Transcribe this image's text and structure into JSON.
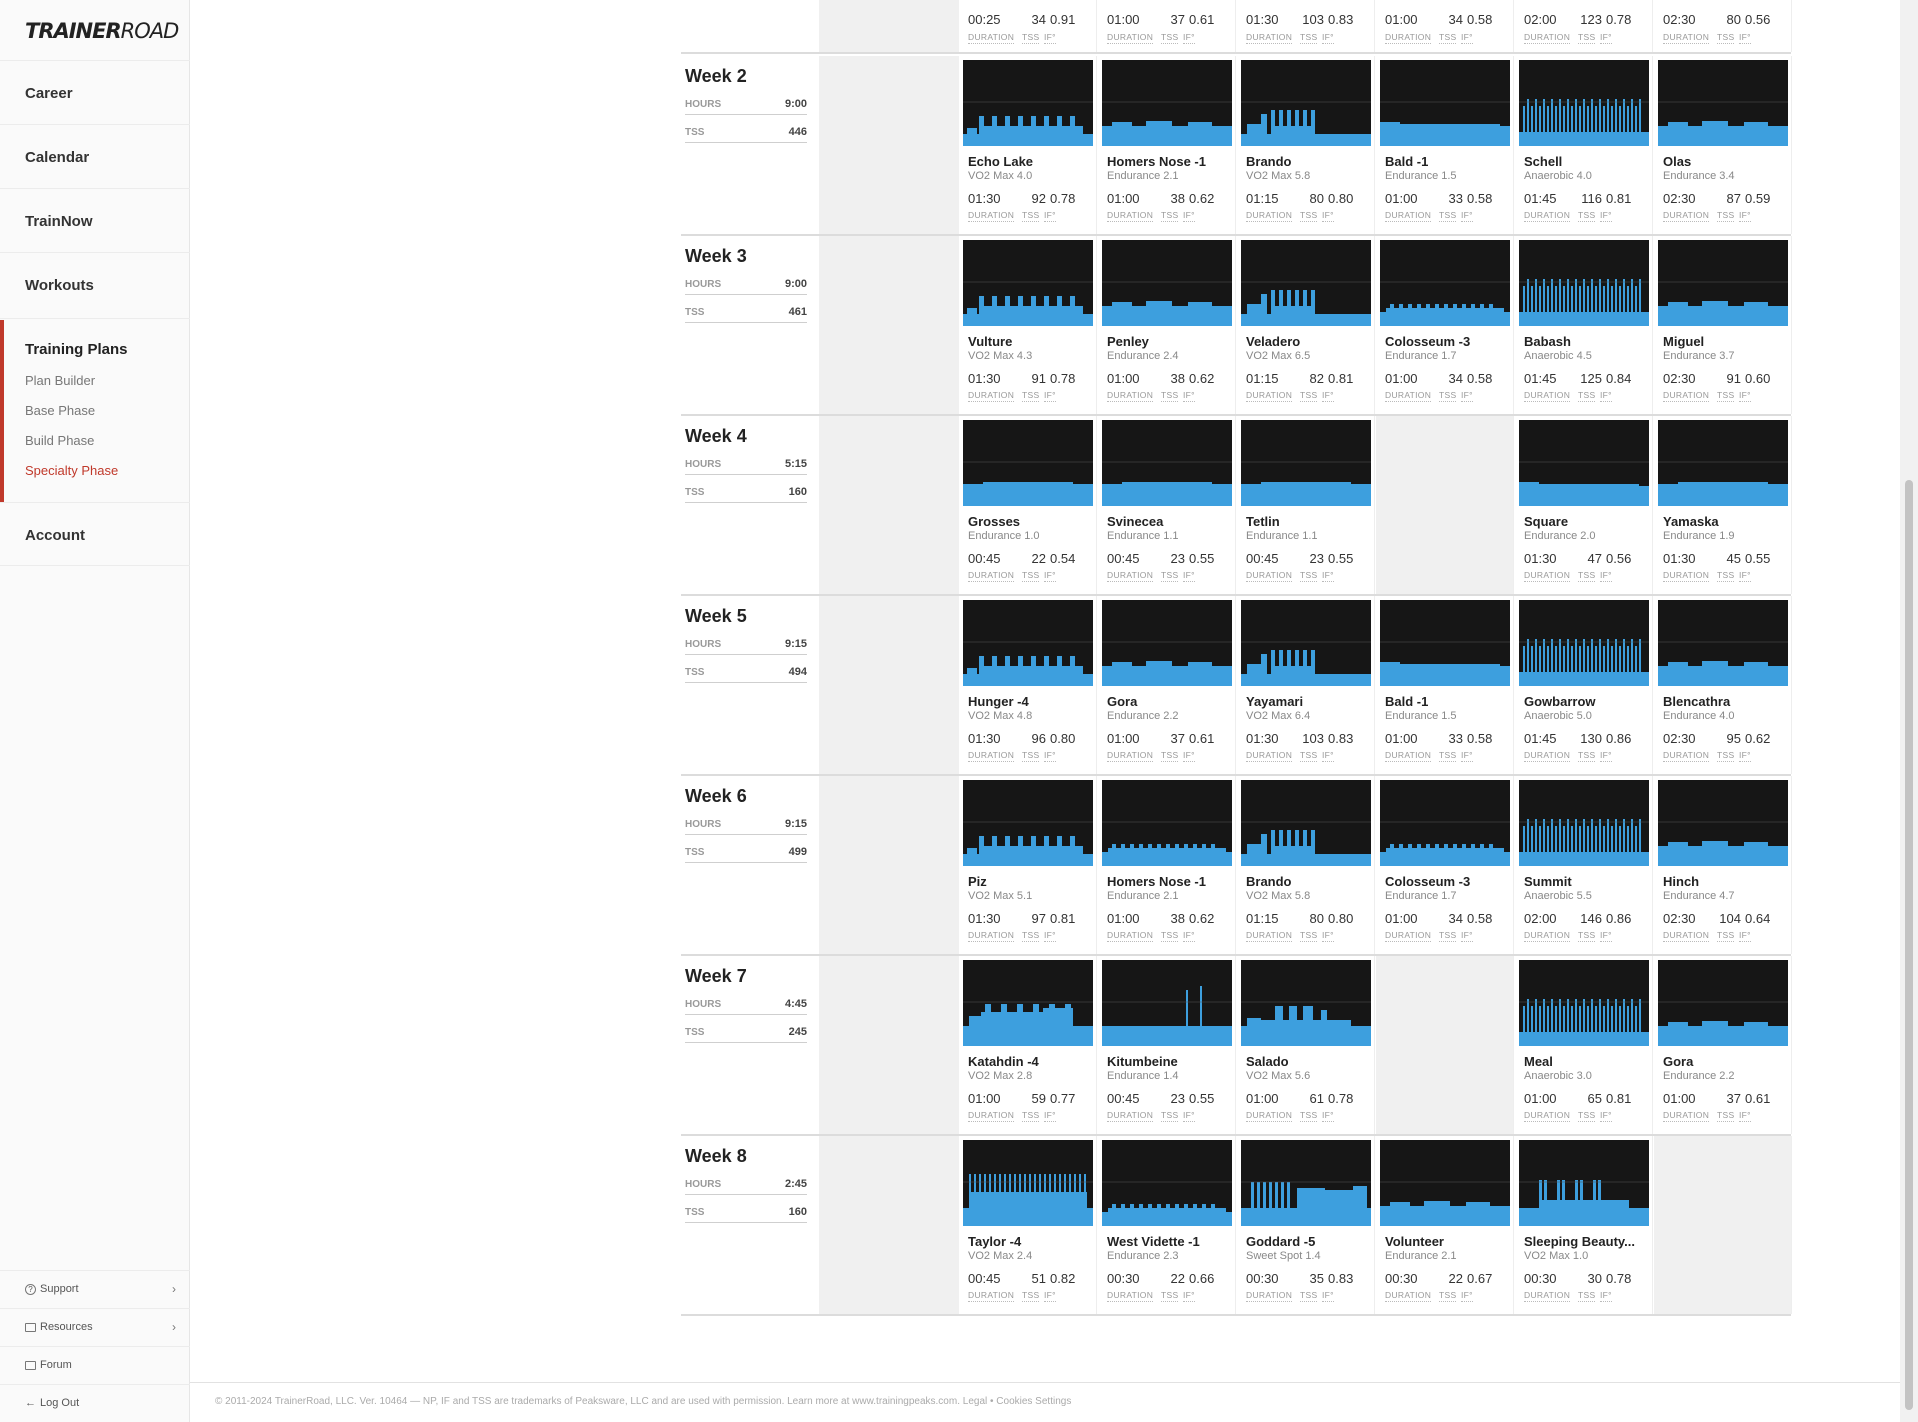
{
  "brand": {
    "bold": "TRAINER",
    "light": "ROAD"
  },
  "nav": {
    "career": "Career",
    "calendar": "Calendar",
    "trainnow": "TrainNow",
    "workouts": "Workouts",
    "training_plans": "Training Plans",
    "sub": [
      "Plan Builder",
      "Base Phase",
      "Build Phase",
      "Specialty Phase"
    ],
    "account": "Account"
  },
  "bottom_nav": {
    "support": "Support",
    "resources": "Resources",
    "forum": "Forum",
    "logout": "Log Out"
  },
  "labels": {
    "hours": "HOURS",
    "tss": "TSS",
    "duration": "DURATION",
    "tss_short": "TSS",
    "if": "IF°"
  },
  "footer": "© 2011-2024 TrainerRoad, LLC. Ver. 10464 — NP, IF and TSS are trademarks of Peaksware, LLC and are used with permission. Learn more at www.trainingpeaks.com. Legal • Cookies Settings",
  "week1_partial": [
    {
      "d": "00:25",
      "t": "34",
      "i": "0.91"
    },
    {
      "d": "01:00",
      "t": "37",
      "i": "0.61"
    },
    {
      "d": "01:30",
      "t": "103",
      "i": "0.83"
    },
    {
      "d": "01:00",
      "t": "34",
      "i": "0.58"
    },
    {
      "d": "02:00",
      "t": "123",
      "i": "0.78"
    },
    {
      "d": "02:30",
      "t": "80",
      "i": "0.56"
    }
  ],
  "weeks": [
    {
      "title": "Week 2",
      "hours": "9:00",
      "tss": "446",
      "workouts": [
        {
          "n": "Echo Lake",
          "z": "VO2 Max 4.0",
          "d": "01:30",
          "t": "92",
          "i": "0.78",
          "p": "vo2"
        },
        {
          "n": "Homers Nose -1",
          "z": "Endurance 2.1",
          "d": "01:00",
          "t": "38",
          "i": "0.62",
          "p": "endb"
        },
        {
          "n": "Brando",
          "z": "VO2 Max 5.8",
          "d": "01:15",
          "t": "80",
          "i": "0.80",
          "p": "short"
        },
        {
          "n": "Bald -1",
          "z": "Endurance 1.5",
          "d": "01:00",
          "t": "33",
          "i": "0.58",
          "p": "endf"
        },
        {
          "n": "Schell",
          "z": "Anaerobic 4.0",
          "d": "01:45",
          "t": "116",
          "i": "0.81",
          "p": "anae"
        },
        {
          "n": "Olas",
          "z": "Endurance 3.4",
          "d": "02:30",
          "t": "87",
          "i": "0.59",
          "p": "endb"
        }
      ]
    },
    {
      "title": "Week 3",
      "hours": "9:00",
      "tss": "461",
      "workouts": [
        {
          "n": "Vulture",
          "z": "VO2 Max 4.3",
          "d": "01:30",
          "t": "91",
          "i": "0.78",
          "p": "vo2"
        },
        {
          "n": "Penley",
          "z": "Endurance 2.4",
          "d": "01:00",
          "t": "38",
          "i": "0.62",
          "p": "endb"
        },
        {
          "n": "Veladero",
          "z": "VO2 Max 6.5",
          "d": "01:15",
          "t": "82",
          "i": "0.81",
          "p": "short"
        },
        {
          "n": "Colosseum -3",
          "z": "Endurance 1.7",
          "d": "01:00",
          "t": "34",
          "i": "0.58",
          "p": "endm"
        },
        {
          "n": "Babash",
          "z": "Anaerobic 4.5",
          "d": "01:45",
          "t": "125",
          "i": "0.84",
          "p": "anae"
        },
        {
          "n": "Miguel",
          "z": "Endurance 3.7",
          "d": "02:30",
          "t": "91",
          "i": "0.60",
          "p": "endb"
        }
      ]
    },
    {
      "title": "Week 4",
      "hours": "5:15",
      "tss": "160",
      "workouts": [
        {
          "n": "Grosses",
          "z": "Endurance 1.0",
          "d": "00:45",
          "t": "22",
          "i": "0.54",
          "p": "flat"
        },
        {
          "n": "Svinecea",
          "z": "Endurance 1.1",
          "d": "00:45",
          "t": "23",
          "i": "0.55",
          "p": "flat"
        },
        {
          "n": "Tetlin",
          "z": "Endurance 1.1",
          "d": "00:45",
          "t": "23",
          "i": "0.55",
          "p": "flat"
        },
        null,
        {
          "n": "Square",
          "z": "Endurance 2.0",
          "d": "01:30",
          "t": "47",
          "i": "0.56",
          "p": "endf"
        },
        {
          "n": "Yamaska",
          "z": "Endurance 1.9",
          "d": "01:30",
          "t": "45",
          "i": "0.55",
          "p": "flat"
        }
      ]
    },
    {
      "title": "Week 5",
      "hours": "9:15",
      "tss": "494",
      "workouts": [
        {
          "n": "Hunger -4",
          "z": "VO2 Max 4.8",
          "d": "01:30",
          "t": "96",
          "i": "0.80",
          "p": "vo2"
        },
        {
          "n": "Gora",
          "z": "Endurance 2.2",
          "d": "01:00",
          "t": "37",
          "i": "0.61",
          "p": "endb"
        },
        {
          "n": "Yayamari",
          "z": "VO2 Max 6.4",
          "d": "01:30",
          "t": "103",
          "i": "0.83",
          "p": "short"
        },
        {
          "n": "Bald -1",
          "z": "Endurance 1.5",
          "d": "01:00",
          "t": "33",
          "i": "0.58",
          "p": "endf"
        },
        {
          "n": "Gowbarrow",
          "z": "Anaerobic 5.0",
          "d": "01:45",
          "t": "130",
          "i": "0.86",
          "p": "anae"
        },
        {
          "n": "Blencathra",
          "z": "Endurance 4.0",
          "d": "02:30",
          "t": "95",
          "i": "0.62",
          "p": "endb"
        }
      ]
    },
    {
      "title": "Week 6",
      "hours": "9:15",
      "tss": "499",
      "workouts": [
        {
          "n": "Piz",
          "z": "VO2 Max 5.1",
          "d": "01:30",
          "t": "97",
          "i": "0.81",
          "p": "vo2"
        },
        {
          "n": "Homers Nose -1",
          "z": "Endurance 2.1",
          "d": "01:00",
          "t": "38",
          "i": "0.62",
          "p": "endm"
        },
        {
          "n": "Brando",
          "z": "VO2 Max 5.8",
          "d": "01:15",
          "t": "80",
          "i": "0.80",
          "p": "short"
        },
        {
          "n": "Colosseum -3",
          "z": "Endurance 1.7",
          "d": "01:00",
          "t": "34",
          "i": "0.58",
          "p": "endm"
        },
        {
          "n": "Summit",
          "z": "Anaerobic 5.5",
          "d": "02:00",
          "t": "146",
          "i": "0.86",
          "p": "anae"
        },
        {
          "n": "Hinch",
          "z": "Endurance 4.7",
          "d": "02:30",
          "t": "104",
          "i": "0.64",
          "p": "endb"
        }
      ]
    },
    {
      "title": "Week 7",
      "hours": "4:45",
      "tss": "245",
      "workouts": [
        {
          "n": "Katahdin -4",
          "z": "VO2 Max 2.8",
          "d": "01:00",
          "t": "59",
          "i": "0.77",
          "p": "kat"
        },
        {
          "n": "Kitumbeine",
          "z": "Endurance 1.4",
          "d": "00:45",
          "t": "23",
          "i": "0.55",
          "p": "kit"
        },
        {
          "n": "Salado",
          "z": "VO2 Max 5.6",
          "d": "01:00",
          "t": "61",
          "i": "0.78",
          "p": "sal"
        },
        null,
        {
          "n": "Meal",
          "z": "Anaerobic 3.0",
          "d": "01:00",
          "t": "65",
          "i": "0.81",
          "p": "anae"
        },
        {
          "n": "Gora",
          "z": "Endurance 2.2",
          "d": "01:00",
          "t": "37",
          "i": "0.61",
          "p": "endb"
        }
      ]
    },
    {
      "title": "Week 8",
      "hours": "2:45",
      "tss": "160",
      "workouts": [
        {
          "n": "Taylor -4",
          "z": "VO2 Max 2.4",
          "d": "00:45",
          "t": "51",
          "i": "0.82",
          "p": "tay"
        },
        {
          "n": "West Vidette -1",
          "z": "Endurance 2.3",
          "d": "00:30",
          "t": "22",
          "i": "0.66",
          "p": "endm"
        },
        {
          "n": "Goddard -5",
          "z": "Sweet Spot 1.4",
          "d": "00:30",
          "t": "35",
          "i": "0.83",
          "p": "god"
        },
        {
          "n": "Volunteer",
          "z": "Endurance 2.1",
          "d": "00:30",
          "t": "22",
          "i": "0.67",
          "p": "endb"
        },
        {
          "n": "Sleeping Beauty...",
          "z": "VO2 Max 1.0",
          "d": "00:30",
          "t": "30",
          "i": "0.78",
          "p": "sleep"
        },
        null
      ]
    }
  ],
  "colors": {
    "graph_bg": "#161616",
    "graph_fill": "#3d9fde",
    "accent": "#c0392b"
  }
}
